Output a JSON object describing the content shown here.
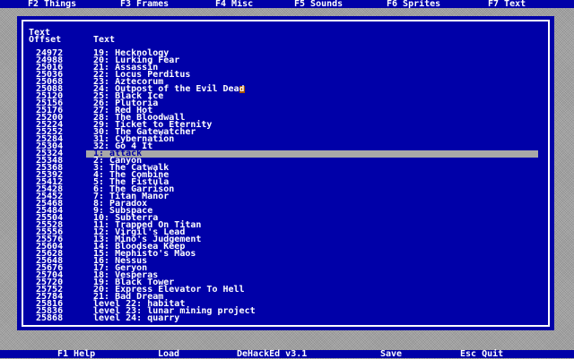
{
  "menu": [
    "F2 Things",
    "F3 Frames",
    "F4 Misc",
    "F5 Sounds",
    "F6 Sprites",
    "F7 Text"
  ],
  "panel": {
    "header_offset_line1": "Text",
    "header_offset_line2": "Offset",
    "header_text": "Text"
  },
  "rows": [
    {
      "offset": "24972",
      "text": "19: Hecknology"
    },
    {
      "offset": "24988",
      "text": "20: Lurking Fear"
    },
    {
      "offset": "25016",
      "text": "21: Assassin"
    },
    {
      "offset": "25036",
      "text": "22: Locus Perditus"
    },
    {
      "offset": "25068",
      "text": "23: Aztecorum"
    },
    {
      "offset": "25088",
      "text": "24: Outpost of the Evil Dea"
    },
    {
      "offset": "25120",
      "text": "25: Black Ice"
    },
    {
      "offset": "25156",
      "text": "26: Plutoria"
    },
    {
      "offset": "25176",
      "text": "27: Red Hot"
    },
    {
      "offset": "25200",
      "text": "28: The Bloodwall"
    },
    {
      "offset": "25224",
      "text": "29: Ticket to Eternity"
    },
    {
      "offset": "25252",
      "text": "30: The Gatewatcher"
    },
    {
      "offset": "25284",
      "text": "31: Cybernation"
    },
    {
      "offset": "25304",
      "text": "32: Go 4 It"
    },
    {
      "offset": "25324",
      "text": "1: attack"
    },
    {
      "offset": "25348",
      "text": "2: Canyon"
    },
    {
      "offset": "25368",
      "text": "3: The Catwalk"
    },
    {
      "offset": "25392",
      "text": "4: The Combine"
    },
    {
      "offset": "25412",
      "text": "5: The Fistula"
    },
    {
      "offset": "25428",
      "text": "6: The Garrison"
    },
    {
      "offset": "25452",
      "text": "7: Titan Manor"
    },
    {
      "offset": "25468",
      "text": "8: Paradox"
    },
    {
      "offset": "25484",
      "text": "9: Subspace"
    },
    {
      "offset": "25504",
      "text": "10: Subterra"
    },
    {
      "offset": "25528",
      "text": "11: Trapped On Titan"
    },
    {
      "offset": "25556",
      "text": "12: Virgil's Lead"
    },
    {
      "offset": "25576",
      "text": "13: Mino's Judgement"
    },
    {
      "offset": "25604",
      "text": "14: Bloodsea Keep"
    },
    {
      "offset": "25628",
      "text": "15: Mephisto's Maos"
    },
    {
      "offset": "25648",
      "text": "16: Nessus"
    },
    {
      "offset": "25676",
      "text": "17: Geryon"
    },
    {
      "offset": "25704",
      "text": "18: Vesperas"
    },
    {
      "offset": "25720",
      "text": "19: Black Tower"
    },
    {
      "offset": "25752",
      "text": "20: Express Elevator To Hell"
    },
    {
      "offset": "25784",
      "text": "21: Bad Dream"
    },
    {
      "offset": "25816",
      "text": "level 22: habitat"
    },
    {
      "offset": "25836",
      "text": "level 23: lunar mining project"
    },
    {
      "offset": "25868",
      "text": "level 24: quarry"
    }
  ],
  "selected_index": 14,
  "cursor_row_index": 5,
  "cursor_char": "d",
  "footer": {
    "help": "F1 Help",
    "load": "Load",
    "title": "DeHackEd v3.1",
    "save": "Save",
    "quit": "Esc Quit"
  },
  "colors": {
    "panel_bg": "#0000a8",
    "text": "#ffffff",
    "highlight": "#a8a8a8",
    "cursor": "#a85400"
  }
}
